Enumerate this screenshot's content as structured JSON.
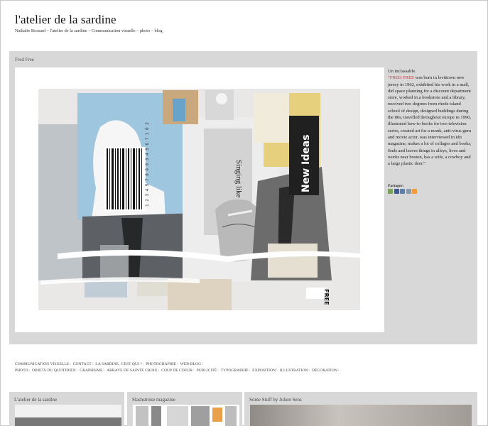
{
  "site": {
    "title": "l'atelier de la sardine",
    "subtitle": "Nathalie Bossard – l'atelier de la sardine – Communication visuelle – photo – blog"
  },
  "post": {
    "title": "Fred Free",
    "lead": "Un inclassable.",
    "quote_name": "“FRED FREE",
    "body": " was born in levittown new jersey in 1962, exhibited his work in a mall, did space planning for a discount department store, worked in a bookstore and a library, received two degrees from rhode island school of design, designed buildings during the 80s, travelled throughout europe in 1990, illustrated how-to books for two television series, created art for a monk, anti-virus guru and movie actor, was interviewed in idn magazine, makes a lot of collages and books, finds and leaves things in alleys, lives and works near boston, has a wife, a cowboy and a large plastic deer.”",
    "share_label": "Partager:",
    "artwork_text": {
      "barcode_number": "1 2 3 4 5 7 8 9 0 3 4 5 6 7 1 0 2",
      "singing": "Singing like",
      "new_ideas": "New Ideas",
      "free": "FREE"
    }
  },
  "share_icons": [
    {
      "name": "email-share-icon",
      "color": "#7aa05a"
    },
    {
      "name": "facebook-share-icon",
      "color": "#3b5998"
    },
    {
      "name": "delicious-share-icon",
      "color": "#5b7fb5"
    },
    {
      "name": "print-share-icon",
      "color": "#8899aa"
    },
    {
      "name": "rss-share-icon",
      "color": "#f39a3c"
    }
  ],
  "nav": {
    "row1": [
      "Communication visuelle",
      "Contact",
      "La sardine, c'est qui ?",
      "Photographie",
      "Web-blog"
    ],
    "row2": [
      "Photo",
      "Objets du quotidien",
      "Graphisme",
      "Abbaye de Sainte Croix",
      "Coup de coeur",
      "Publicité",
      "Typographie",
      "Exposition",
      "Illustration",
      "Décoration"
    ]
  },
  "cards": [
    {
      "title": "L'atelier de la sardine"
    },
    {
      "title": "Slashstroke magazine"
    },
    {
      "title": "Some Stuff by Julien Sens"
    }
  ]
}
